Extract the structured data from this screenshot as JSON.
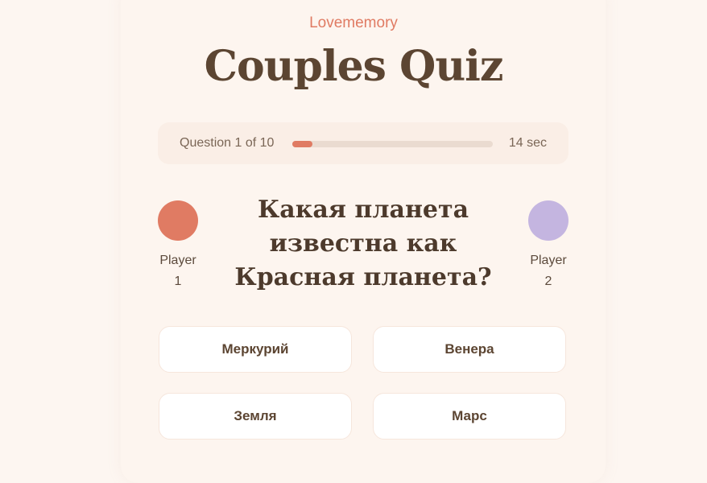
{
  "brand": "Lovememory",
  "title": "Couples Quiz",
  "progress": {
    "counter": "Question 1 of 10",
    "fraction": 0.1,
    "timer": "14 sec",
    "accent_color": "#e07b63"
  },
  "players": [
    {
      "label": "Player",
      "number": "1",
      "color": "#e07b63"
    },
    {
      "label": "Player",
      "number": "2",
      "color": "#c4b5e0"
    }
  ],
  "question": "Какая планета известна как Красная планета?",
  "answers": [
    "Меркурий",
    "Венера",
    "Земля",
    "Марс"
  ]
}
